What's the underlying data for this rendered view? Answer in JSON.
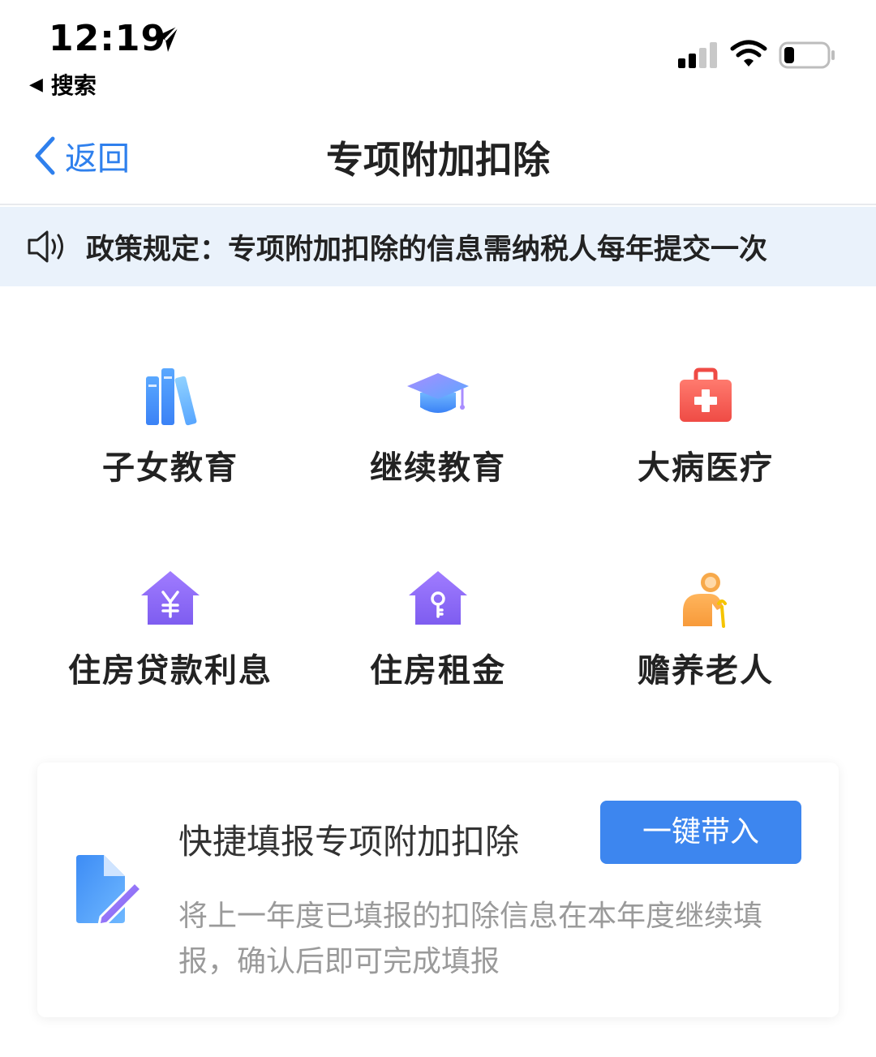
{
  "status_bar": {
    "time": "12:19",
    "back_app_label": "搜索"
  },
  "nav": {
    "back_label": "返回",
    "title": "专项附加扣除"
  },
  "notice": {
    "text": "政策规定：专项附加扣除的信息需纳税人每年提交一次"
  },
  "categories": [
    {
      "label": "子女教育",
      "icon": "books-icon"
    },
    {
      "label": "继续教育",
      "icon": "graduation-cap-icon"
    },
    {
      "label": "大病医疗",
      "icon": "medical-kit-icon"
    },
    {
      "label": "住房贷款利息",
      "icon": "house-yen-icon"
    },
    {
      "label": "住房租金",
      "icon": "house-key-icon"
    },
    {
      "label": "赡养老人",
      "icon": "elderly-person-icon"
    }
  ],
  "quick_fill": {
    "title": "快捷填报专项附加扣除",
    "button_label": "一键带入",
    "description": "将上一年度已填报的扣除信息在本年度继续填报，确认后即可完成填报"
  },
  "colors": {
    "accent": "#3d86ef",
    "link": "#2f80ed",
    "notice_bg": "#eaf2fb",
    "purple": "#8e6cf0",
    "red": "#f0524c",
    "orange": "#f7a94a"
  }
}
